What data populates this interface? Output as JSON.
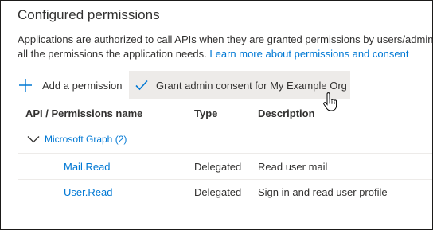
{
  "section": {
    "title": "Configured permissions",
    "description_line1": "Applications are authorized to call APIs when they are granted permissions by users/admins",
    "description_line2": "all the permissions the application needs.",
    "learn_more_link": "Learn more about permissions and consent"
  },
  "toolbar": {
    "add_label": "Add a permission",
    "add_icon": "plus-icon",
    "grant_label": "Grant admin consent for My Example Org",
    "grant_icon": "checkmark-icon"
  },
  "table": {
    "headers": [
      "API / Permissions name",
      "Type",
      "Description"
    ],
    "group": {
      "label": "Microsoft Graph (2)",
      "icon": "chevron-down-icon"
    },
    "rows": [
      {
        "name": "Mail.Read",
        "type": "Delegated",
        "description": "Read user mail"
      },
      {
        "name": "User.Read",
        "type": "Delegated",
        "description": "Sign in and read user profile"
      }
    ]
  },
  "colors": {
    "link": "#0078d4",
    "button_hover_bg": "#edebe9",
    "text": "#323130"
  }
}
